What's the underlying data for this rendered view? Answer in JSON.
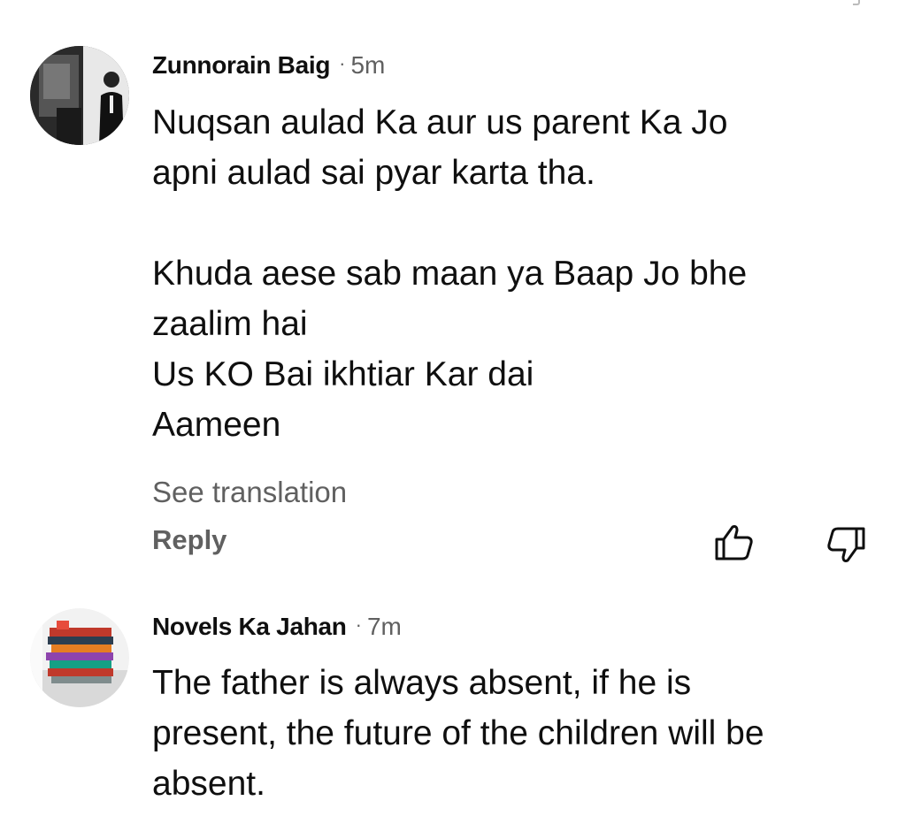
{
  "comments": [
    {
      "author": "Zunnorain Baig",
      "separator": "·",
      "time": "5m",
      "text": "Nuqsan aulad Ka aur us parent Ka Jo\napni aulad sai pyar karta tha.\n\nKhuda aese sab maan ya Baap Jo bhe\nzaalim hai\nUs KO Bai ikhtiar Kar dai\nAameen",
      "see_translation": "See translation",
      "reply": "Reply",
      "like_icon": "thumb-up-icon",
      "dislike_icon": "thumb-down-icon"
    },
    {
      "author": "Novels Ka Jahan",
      "separator": "·",
      "time": "7m",
      "text": "The father is always absent, if he is\npresent, the future of the children will be\nabsent."
    }
  ],
  "colors": {
    "text_primary": "#0f0f0f",
    "text_secondary": "#606060",
    "background": "#ffffff"
  }
}
